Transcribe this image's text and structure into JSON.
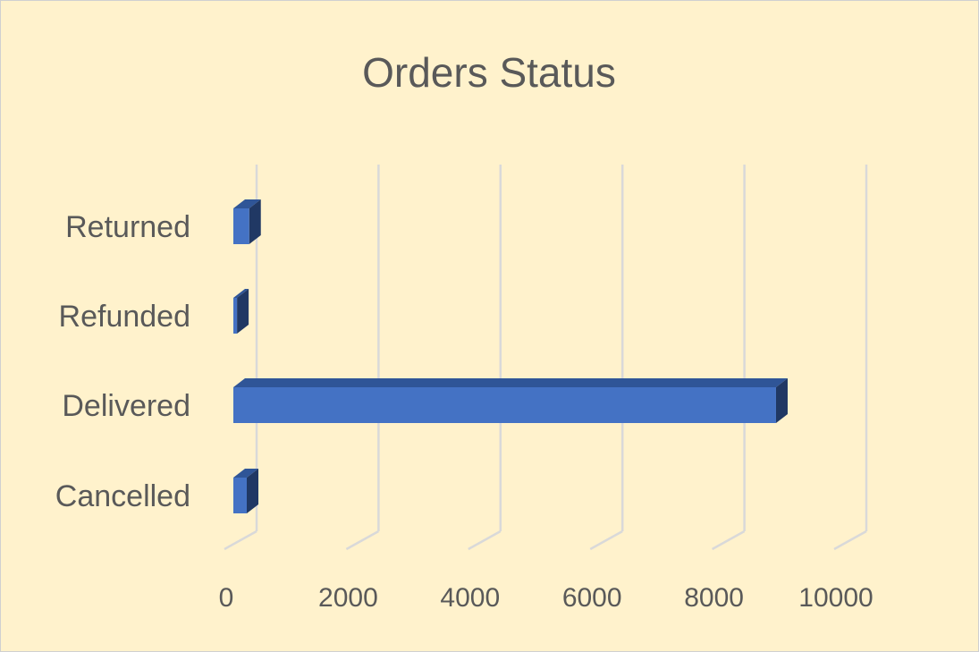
{
  "chart_data": {
    "type": "bar",
    "orientation": "horizontal",
    "style": "3d",
    "title": "Orders Status",
    "categories": [
      "Cancelled",
      "Delivered",
      "Refunded",
      "Returned"
    ],
    "values": [
      220,
      8900,
      60,
      260
    ],
    "xlim": [
      0,
      10000
    ],
    "x_ticks": [
      "0",
      "2000",
      "4000",
      "6000",
      "8000",
      "10000"
    ],
    "grid": true,
    "legend": false,
    "colors": {
      "background": "#fff2cc",
      "bar_front": "#4472c4",
      "bar_top": "#2f5597",
      "bar_side": "#203864",
      "gridline": "#d9d9d9",
      "text": "#595959"
    }
  }
}
